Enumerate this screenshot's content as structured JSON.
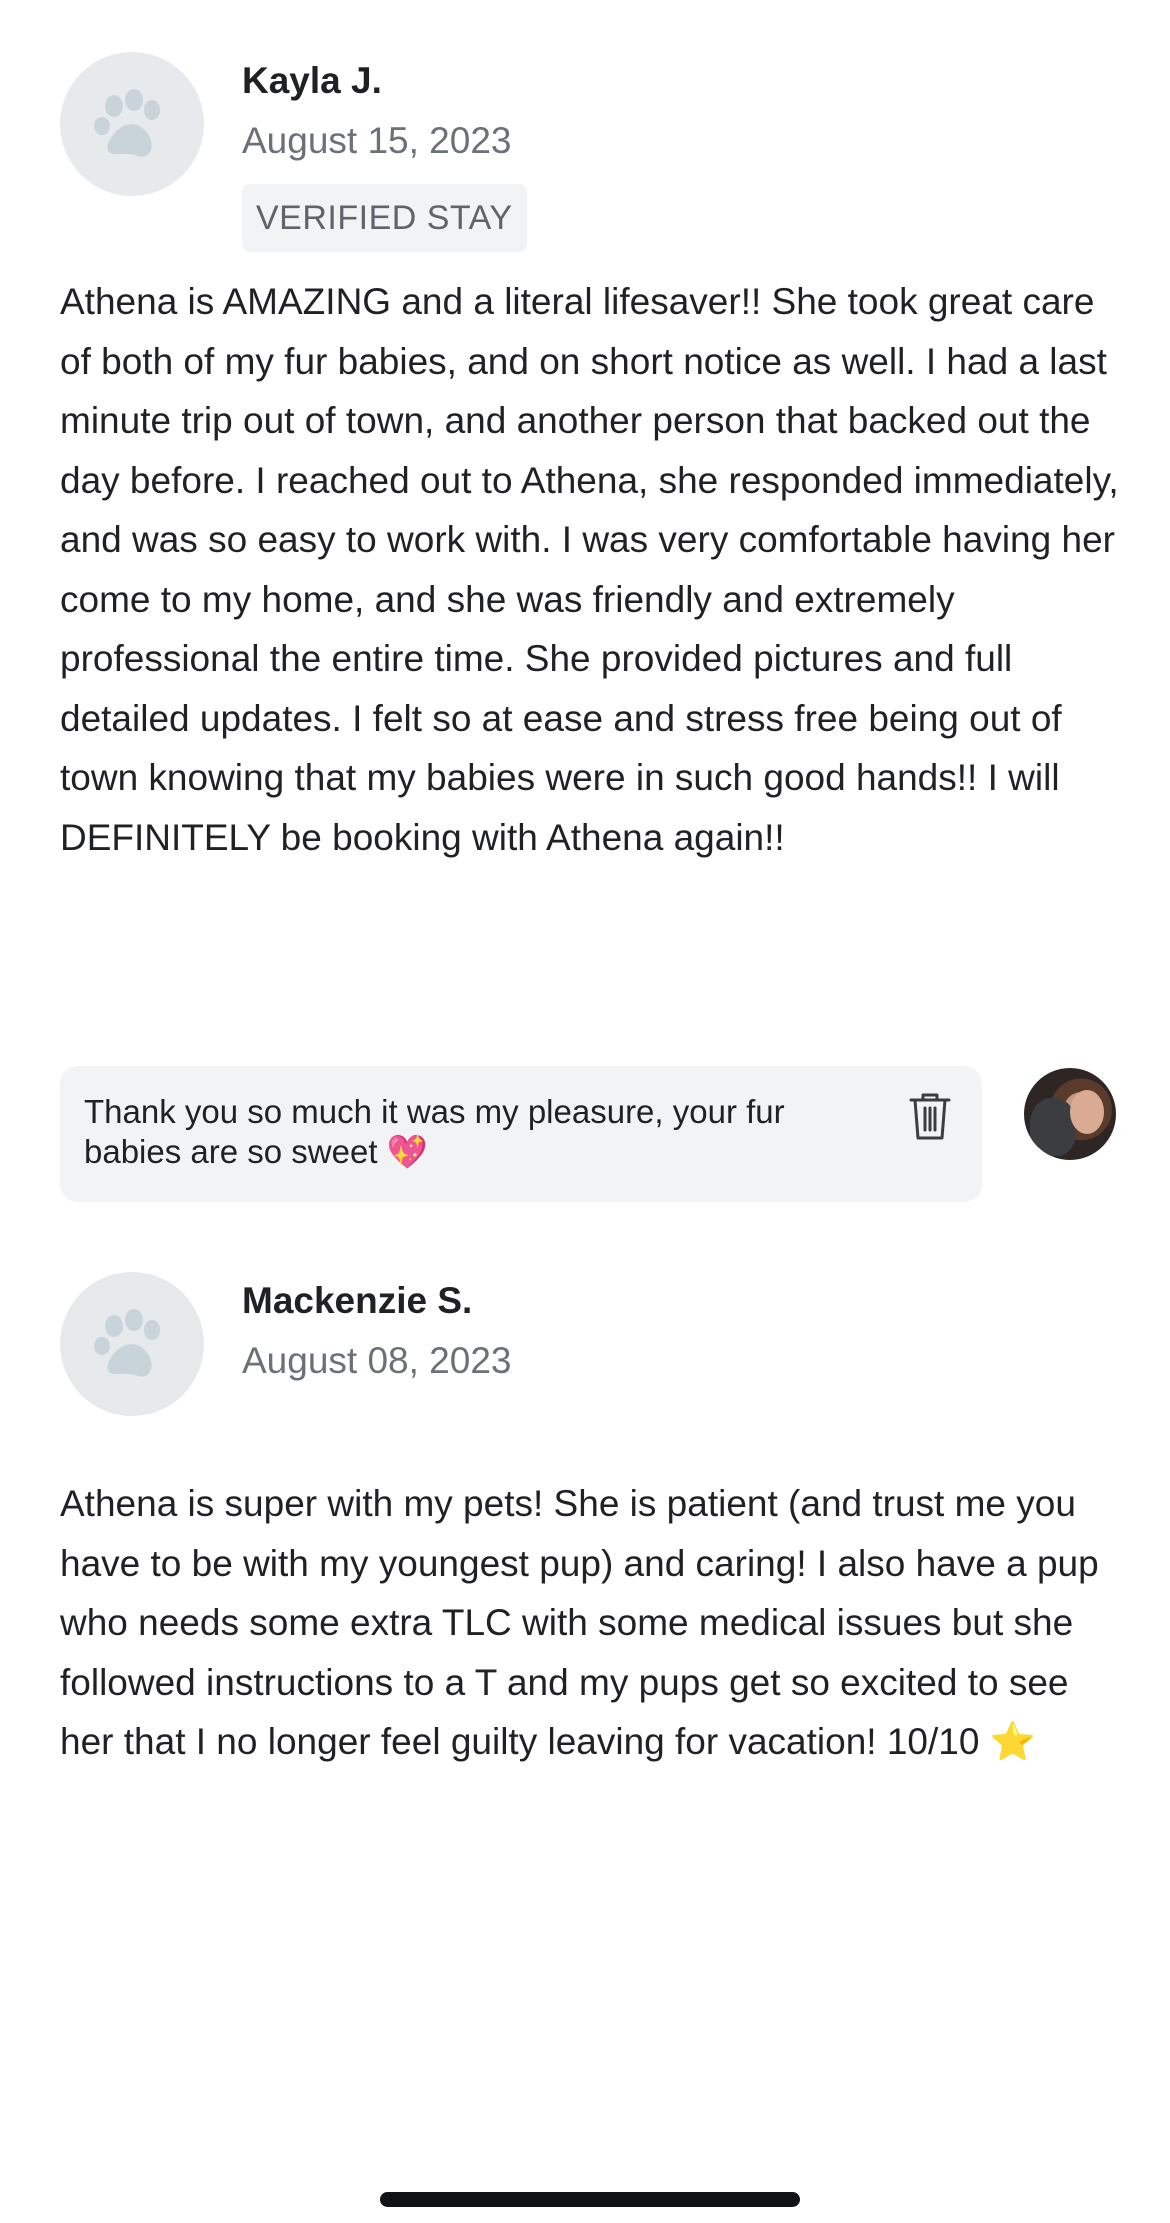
{
  "reviews": [
    {
      "name": "Kayla J.",
      "date": "August 15, 2023",
      "badge": "VERIFIED STAY",
      "avatar_icon": "paw-icon",
      "body": "Athena is AMAZING and a literal lifesaver!! She took great care of both of my fur babies, and on short notice as well. I had a last minute trip out of town, and another person that backed out the day before. I reached out to Athena, she responded immediately, and was so easy to work with. I was very comfortable having her come to my home, and she was friendly and extremely professional the entire time. She provided pictures and full detailed updates. I felt so at ease and stress free being out of town knowing that my babies were in such good hands!! I will DEFINITELY be booking with Athena again!!",
      "reply": {
        "text": "Thank you so much it was my pleasure, your fur babies are so sweet 💖",
        "delete_icon": "trash-icon"
      }
    },
    {
      "name": "Mackenzie S.",
      "date": "August 08, 2023",
      "avatar_icon": "paw-icon",
      "body": "Athena is super with my pets! She is patient (and trust me you have to be with my youngest pup) and caring! I also have a pup who needs some extra TLC with some medical issues but she followed instructions to a T and my pups get so excited to see her that I no longer feel guilty leaving for vacation! 10/10 ⭐"
    }
  ],
  "colors": {
    "avatar_bg": "#e7eaed",
    "paw": "#c9d4da",
    "badge_bg": "#f2f3f5",
    "reply_bg": "#f2f3f5",
    "secondary_text": "#6b7079"
  }
}
